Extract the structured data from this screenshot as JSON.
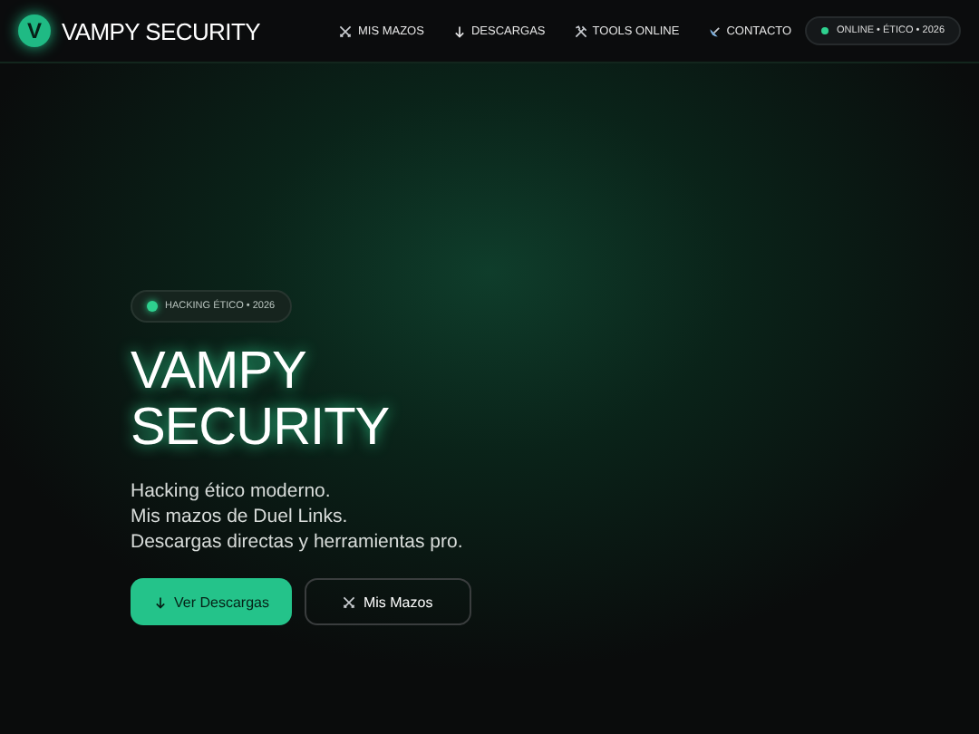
{
  "header": {
    "logo_letter": "V",
    "brand": "VAMPY SECURITY",
    "nav": [
      {
        "label": "MIS MAZOS",
        "kind": "swords"
      },
      {
        "label": "DESCARGAS",
        "kind": "arrow"
      },
      {
        "label": "TOOLS ONLINE",
        "kind": "tools"
      },
      {
        "label": "CONTACTO",
        "kind": "antenna"
      }
    ],
    "status": "ONLINE • ÉTICO • 2026"
  },
  "hero": {
    "badge": "HACKING ÉTICO • 2026",
    "title_lines": [
      "VAMPY",
      "SECURITY"
    ],
    "lines": [
      "Hacking ético moderno.",
      "Mis mazos de Duel Links.",
      "Descargas directas y herramientas pro."
    ],
    "buttons": [
      {
        "label": "Ver Descargas",
        "kind": "primary"
      },
      {
        "label": "Mis Mazos",
        "kind": "secondary"
      }
    ]
  }
}
